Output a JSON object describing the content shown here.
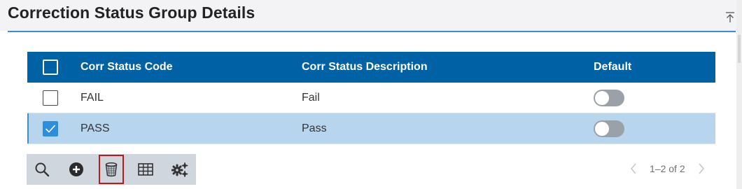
{
  "panel": {
    "title": "Correction Status Group Details",
    "collapse_icon": "collapse-up-icon"
  },
  "table": {
    "columns": [
      "Corr Status Code",
      "Corr Status Description",
      "Default"
    ],
    "rows": [
      {
        "code": "FAIL",
        "description": "Fail",
        "checked": false,
        "default": false,
        "selected": false
      },
      {
        "code": "PASS",
        "description": "Pass",
        "checked": true,
        "default": false,
        "selected": true
      }
    ]
  },
  "toolbar": {
    "icons": [
      "search-icon",
      "add-icon",
      "delete-icon",
      "grid-icon",
      "settings-icon"
    ],
    "active_tool": "delete-icon"
  },
  "pager": {
    "text": "1–2 of 2"
  },
  "colors": {
    "header_bg": "#0062a4",
    "selected_row": "#b8d5ee",
    "accent": "#3a8fdc",
    "active_tool_border": "#c0181f",
    "toolbar_bg": "#d0d6dd"
  }
}
